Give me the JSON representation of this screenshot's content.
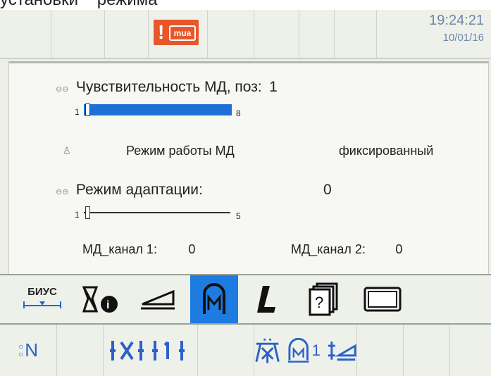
{
  "caption": "установки    режима",
  "status": {
    "alarm_label": "!",
    "alarm_box": "mua",
    "time": "19:24:21",
    "date": "10/01/16"
  },
  "sensitivity": {
    "label": "Чувствительность МД, поз:",
    "value": "1",
    "min": "1",
    "max": "8",
    "level_fraction": 1.0
  },
  "mode": {
    "label": "Режим работы МД",
    "value": "фиксированный"
  },
  "adaptation": {
    "label": "Режим адаптации:",
    "value": "0",
    "min": "1",
    "max": "5",
    "level_fraction": 0.0
  },
  "channels": {
    "ch1_label": "МД_канал 1:",
    "ch1_value": "0",
    "ch2_label": "МД_канал 2:",
    "ch2_value": "0"
  },
  "iconbar": {
    "bius_label": "БИУС",
    "items": [
      "bius-icon",
      "bobbin-info-icon",
      "presser-foot-icon",
      "metal-detector-icon",
      "length-icon",
      "help-icon",
      "screen-icon"
    ],
    "active": "metal-detector-icon"
  },
  "bottombar": {
    "n_label": "N",
    "sub_1": "1"
  },
  "colors": {
    "accent": "#1e7be0",
    "alarm": "#e8572b",
    "clock": "#6c88a6"
  }
}
